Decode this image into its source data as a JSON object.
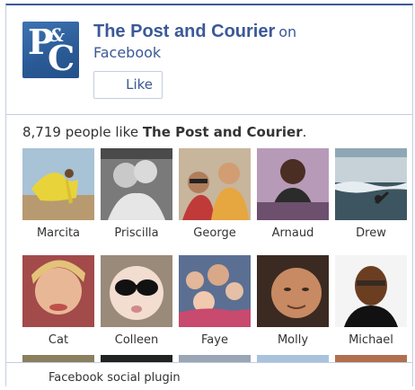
{
  "page": {
    "name": "The Post and Courier",
    "on_text": "on",
    "platform": "Facebook",
    "logo_letters": [
      "P",
      "&",
      "C"
    ]
  },
  "like_button": {
    "label": "Like"
  },
  "likes": {
    "count": "8,719",
    "mid_text": " people like ",
    "page_name": "The Post and Courier",
    "end": "."
  },
  "faces": [
    {
      "name": "Marcita"
    },
    {
      "name": "Priscilla"
    },
    {
      "name": "George"
    },
    {
      "name": "Arnaud"
    },
    {
      "name": "Drew"
    },
    {
      "name": "Cat"
    },
    {
      "name": "Colleen"
    },
    {
      "name": "Faye"
    },
    {
      "name": "Molly"
    },
    {
      "name": "Michael"
    }
  ],
  "footer": {
    "text": "Facebook social plugin"
  },
  "colors": {
    "brand": "#3b5998",
    "border": "#c4cde0",
    "text": "#333333"
  }
}
